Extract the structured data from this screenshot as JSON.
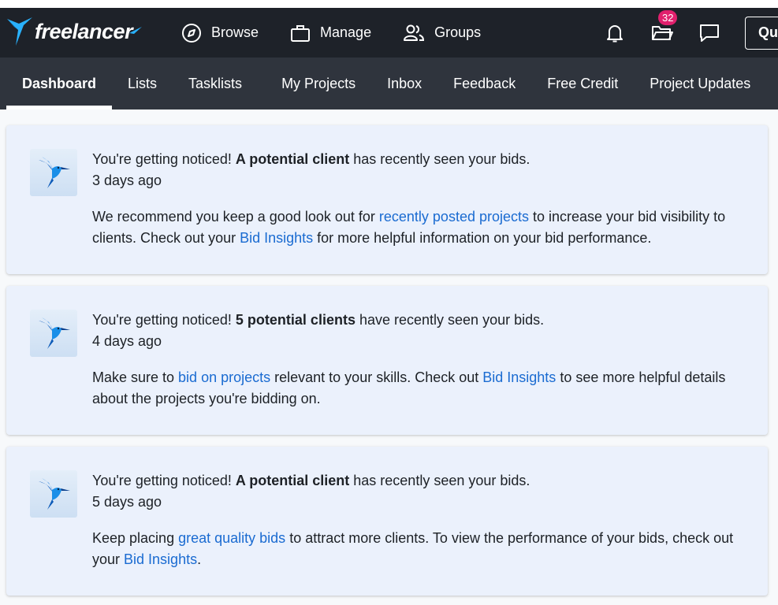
{
  "brand": {
    "name": "freelancer"
  },
  "nav_main": [
    {
      "label": "Browse",
      "icon": "compass-icon"
    },
    {
      "label": "Manage",
      "icon": "briefcase-icon"
    },
    {
      "label": "Groups",
      "icon": "users-icon"
    }
  ],
  "top_icons": {
    "notifications": "bell-icon",
    "projects_badge": "32",
    "messages": "chat-icon",
    "quote_label": "Quo"
  },
  "subnav": [
    {
      "label": "Dashboard",
      "active": true
    },
    {
      "label": "Lists"
    },
    {
      "label": "Tasklists"
    },
    {
      "label": "My Projects"
    },
    {
      "label": "Inbox"
    },
    {
      "label": "Feedback"
    },
    {
      "label": "Free Credit"
    },
    {
      "label": "Project Updates"
    }
  ],
  "notifications": [
    {
      "headline_pre": "You're getting noticed! ",
      "headline_bold": "A potential client",
      "headline_post": " has recently seen your bids.",
      "time": "3 days ago",
      "body": [
        {
          "text": "We recommend you keep a good look out for "
        },
        {
          "text": "recently posted projects",
          "link": true
        },
        {
          "text": " to increase your bid visibility to clients. Check out your "
        },
        {
          "text": "Bid Insights",
          "link": true
        },
        {
          "text": " for more helpful information on your bid performance."
        }
      ]
    },
    {
      "headline_pre": "You're getting noticed! ",
      "headline_bold": "5 potential clients",
      "headline_post": " have recently seen your bids.",
      "time": "4 days ago",
      "body": [
        {
          "text": "Make sure to "
        },
        {
          "text": "bid on projects",
          "link": true
        },
        {
          "text": " relevant to your skills. Check out "
        },
        {
          "text": "Bid Insights",
          "link": true
        },
        {
          "text": " to see more helpful details about the projects you're bidding on."
        }
      ]
    },
    {
      "headline_pre": "You're getting noticed! ",
      "headline_bold": "A potential client",
      "headline_post": " has recently seen your bids.",
      "time": "5 days ago",
      "body": [
        {
          "text": "Keep placing "
        },
        {
          "text": "great quality bids",
          "link": true
        },
        {
          "text": " to attract more clients. To view the performance of your bids, check out your "
        },
        {
          "text": "Bid Insights",
          "link": true
        },
        {
          "text": "."
        }
      ]
    }
  ]
}
